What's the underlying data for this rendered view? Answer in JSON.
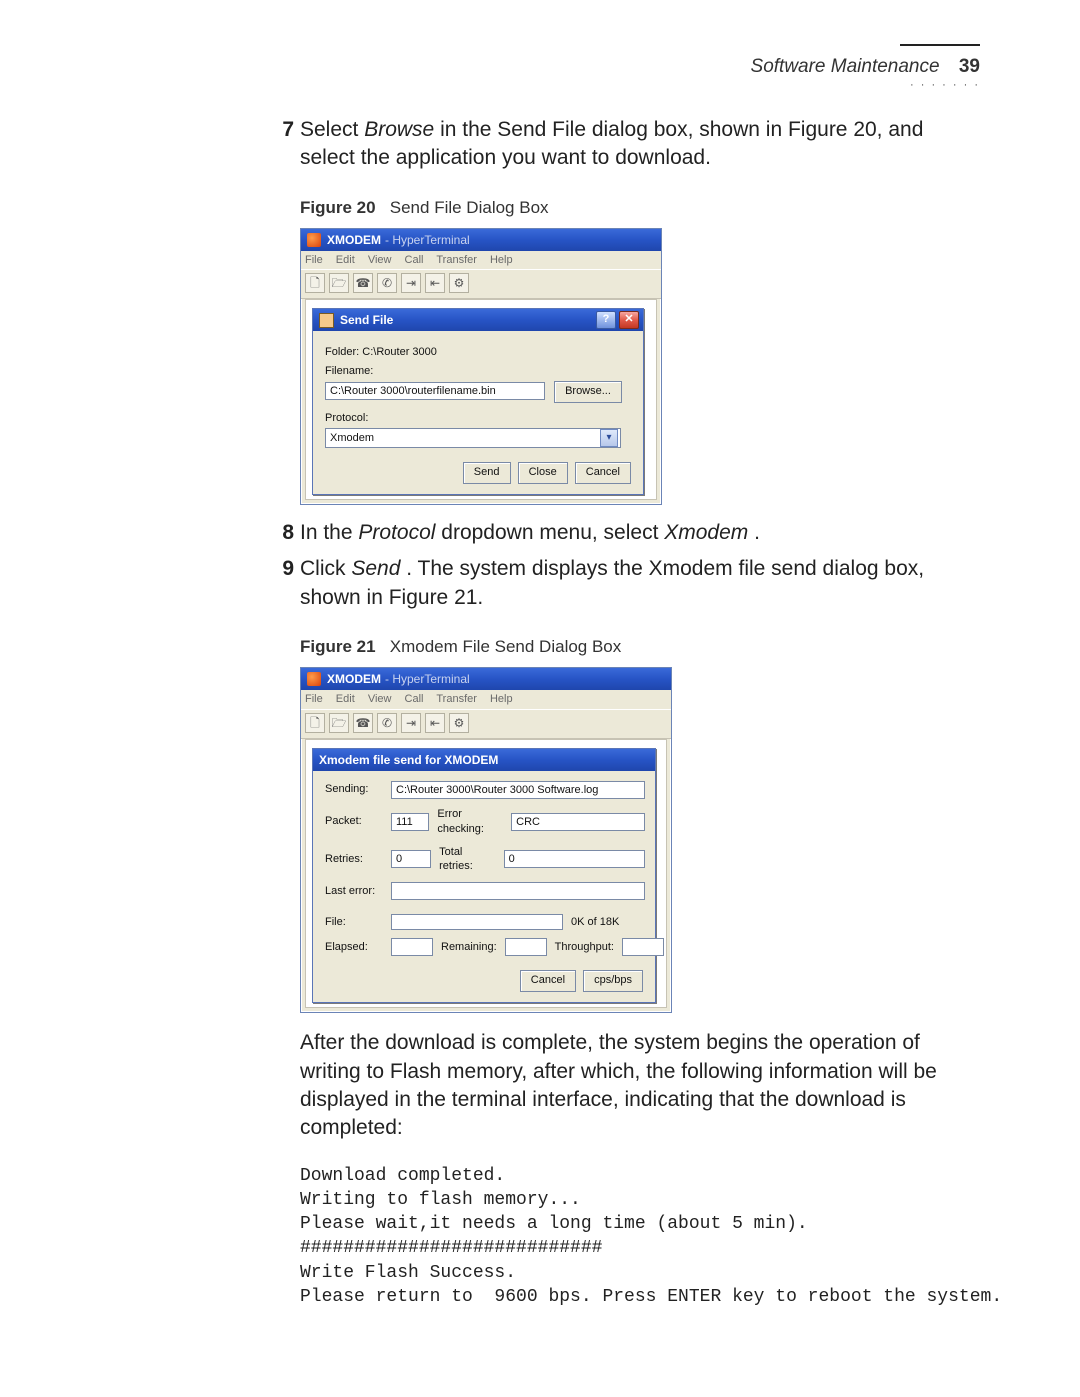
{
  "header": {
    "section": "Software Maintenance",
    "page_number": "39"
  },
  "step7": {
    "num": "7",
    "pre": "Select ",
    "browse": "Browse",
    "post": " in the Send File dialog box, shown in Figure 20, and select the application you want to download."
  },
  "fig20": {
    "label": "Figure 20",
    "caption": "Send File Dialog Box"
  },
  "hyperterminal": {
    "title_main": "XMODEM",
    "title_sub": " - HyperTerminal",
    "menu": [
      "File",
      "Edit",
      "View",
      "Call",
      "Transfer",
      "Help"
    ]
  },
  "sendfile": {
    "title": "Send File",
    "folder_label": "Folder:  C:\\Router 3000",
    "filename_label": "Filename:",
    "filename_value": "C:\\Router 3000\\routerfilename.bin",
    "browse_btn": "Browse...",
    "protocol_label": "Protocol:",
    "protocol_value": "Xmodem",
    "btn_send": "Send",
    "btn_close": "Close",
    "btn_cancel": "Cancel"
  },
  "step8": {
    "num": "8",
    "pre": "In the ",
    "protocol": "Protocol",
    "mid": " dropdown menu, select ",
    "xmodem": "Xmodem",
    "end": "."
  },
  "step9": {
    "num": "9",
    "pre": "Click ",
    "send": "Send",
    "post": ". The system displays the Xmodem file send dialog box, shown in Figure 21."
  },
  "fig21": {
    "label": "Figure 21",
    "caption": "Xmodem File Send Dialog Box"
  },
  "xsend": {
    "title": "Xmodem file send for XMODEM",
    "sending_label": "Sending:",
    "sending_value": "C:\\Router 3000\\Router 3000 Software.log",
    "packet_label": "Packet:",
    "packet_value": "111",
    "errchk_label": "Error checking:",
    "errchk_value": "CRC",
    "retries_label": "Retries:",
    "retries_value": "0",
    "totret_label": "Total retries:",
    "totret_value": "0",
    "lasterr_label": "Last error:",
    "lasterr_value": "",
    "file_label": "File:",
    "file_info": "0K of 18K",
    "elapsed_label": "Elapsed:",
    "elapsed_value": "",
    "remaining_label": "Remaining:",
    "remaining_value": "",
    "thru_label": "Throughput:",
    "thru_value": "",
    "btn_cancel": "Cancel",
    "btn_cps": "cps/bps"
  },
  "tailpara": "After the download is complete, the system begins the operation of writing to Flash memory, after which, the following information will be displayed in the terminal interface, indicating that the download is completed:",
  "terminal": "Download completed.\nWriting to flash memory...\nPlease wait,it needs a long time (about 5 min).\n############################\nWrite Flash Success.\nPlease return to  9600 bps. Press ENTER key to reboot the system."
}
